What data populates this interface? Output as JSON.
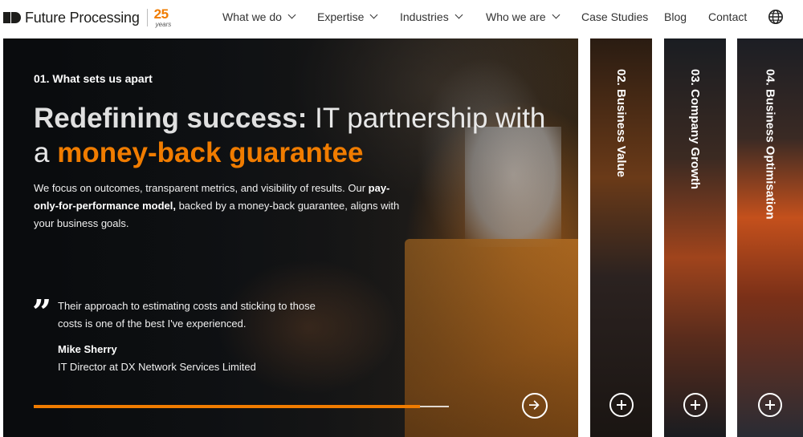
{
  "brand": {
    "name": "Future Processing",
    "badge_number": "25",
    "badge_text": "years",
    "accent_color": "#f07c00"
  },
  "nav": {
    "items": [
      {
        "label": "What we do",
        "dropdown": true
      },
      {
        "label": "Expertise",
        "dropdown": true
      },
      {
        "label": "Industries",
        "dropdown": true
      },
      {
        "label": "Who we are",
        "dropdown": true
      },
      {
        "label": "Case Studies",
        "dropdown": false
      },
      {
        "label": "Blog",
        "dropdown": false
      },
      {
        "label": "Contact",
        "dropdown": false
      }
    ],
    "language_icon": "globe-icon"
  },
  "hero": {
    "eyebrow": "01. What sets us apart",
    "headline_bold": "Redefining success:",
    "headline_light": " IT partnership with",
    "headline_prefix": "a ",
    "headline_accent": "money-back guarantee",
    "intro_before": "We focus on outcomes, transparent metrics, and visibility of results. Our ",
    "intro_bold": "pay-only-for-performance model,",
    "intro_after": " backed by a money-back guarantee, aligns with your business goals.",
    "quote": "Their approach to estimating costs and sticking to those costs is one of the best I've experienced.",
    "author_name": "Mike Sherry",
    "author_role": "IT Director at DX Network Services Limited",
    "progress_fraction": 0.93,
    "next_icon": "arrow-right-circle-icon"
  },
  "panels": [
    {
      "title": "02. Business Value",
      "icon": "plus-circle-icon"
    },
    {
      "title": "03. Company Growth",
      "icon": "plus-circle-icon"
    },
    {
      "title": "04. Business Optimisation",
      "icon": "plus-circle-icon"
    }
  ]
}
